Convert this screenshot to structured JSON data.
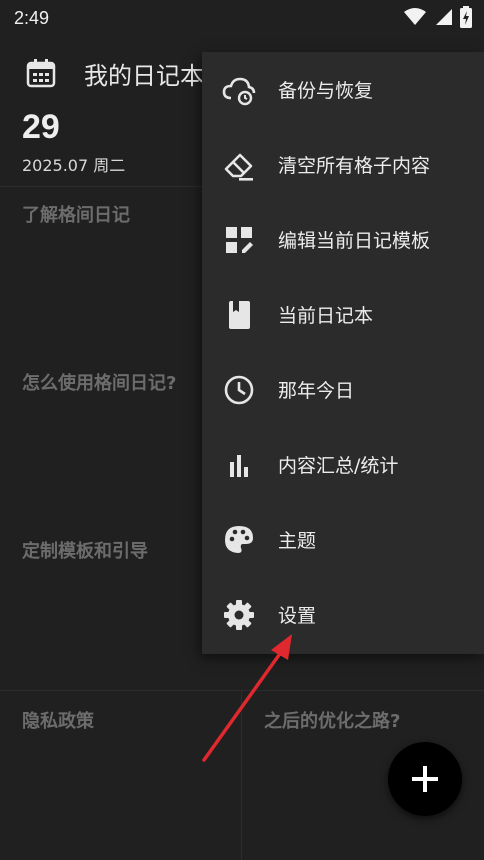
{
  "status_bar": {
    "time": "2:49"
  },
  "header": {
    "title": "我的日记本",
    "day": "29",
    "date_line": "2025.07 周二"
  },
  "grid": {
    "cells": [
      {
        "title": "了解格间日记"
      },
      {
        "title": "怎么使用格间日记?"
      },
      {
        "title": "定制模板和引导"
      },
      {
        "title": "隐私政策"
      },
      {
        "title": "之后的优化之路?"
      }
    ]
  },
  "menu": {
    "items": [
      {
        "label": "备份与恢复",
        "icon": "cloud-backup-icon"
      },
      {
        "label": "清空所有格子内容",
        "icon": "eraser-icon"
      },
      {
        "label": "编辑当前日记模板",
        "icon": "edit-template-icon"
      },
      {
        "label": "当前日记本",
        "icon": "book-icon"
      },
      {
        "label": "那年今日",
        "icon": "clock-icon"
      },
      {
        "label": "内容汇总/统计",
        "icon": "bar-chart-icon"
      },
      {
        "label": "主题",
        "icon": "palette-icon"
      },
      {
        "label": "设置",
        "icon": "gear-icon"
      }
    ]
  },
  "fab": {
    "icon": "plus-icon"
  },
  "colors": {
    "background": "#202020",
    "menu": "#2b2b2b",
    "annotation": "#e0282f"
  }
}
